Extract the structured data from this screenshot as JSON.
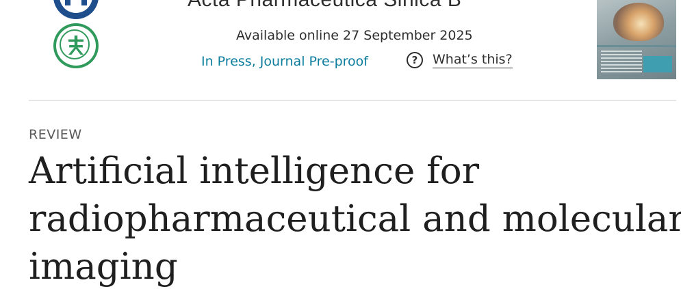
{
  "header": {
    "journal_title": "Acta Pharmaceutica Sinica B",
    "available_online": "Available online 27 September 2025",
    "status": "In Press, Journal Pre-proof",
    "whats_this": "What’s this?",
    "question_icon_glyph": "?"
  },
  "article": {
    "type": "REVIEW",
    "title_lines": [
      "Artificial intelligence for",
      "radiopharmaceutical and molecular",
      "imaging"
    ]
  },
  "icons": {
    "publisher_logo_top": "institution-seal-icon",
    "publisher_logo_bottom": "society-seal-icon",
    "help": "question-circle-icon"
  },
  "colors": {
    "link_teal": "#0c7d9d",
    "text_dark": "#1f1f1f",
    "divider": "#e6e6e6",
    "logo_blue": "#1f4e8c",
    "logo_green": "#2f9a5c"
  }
}
